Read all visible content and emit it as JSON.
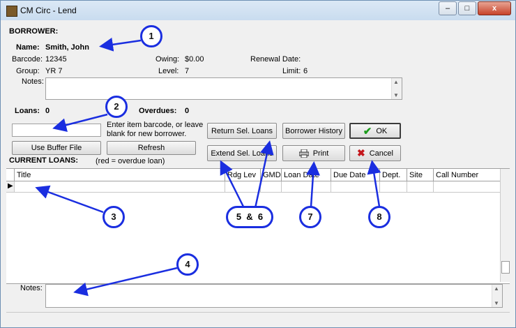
{
  "window": {
    "title": "CM Circ - Lend",
    "minimize": "–",
    "maximize": "□",
    "close": "x"
  },
  "borrower": {
    "section_label": "BORROWER:",
    "name_label": "Name:",
    "name_value": "Smith, John",
    "barcode_label": "Barcode:",
    "barcode_value": "12345",
    "group_label": "Group:",
    "group_value": "YR 7",
    "owing_label": "Owing:",
    "owing_value": "$0.00",
    "level_label": "Level:",
    "level_value": "7",
    "renewal_label": "Renewal Date:",
    "renewal_value": "",
    "limit_label": "Limit:",
    "limit_value": "6",
    "notes_label": "Notes:"
  },
  "loans": {
    "loans_label": "Loans:",
    "loans_count": "0",
    "overdues_label": "Overdues:",
    "overdues_count": "0",
    "barcode_input_value": "",
    "hint": "Enter item barcode, or leave blank for new borrower.",
    "use_buffer_label": "Use Buffer File",
    "refresh_label": "Refresh",
    "current_loans_label": "CURRENT LOANS:",
    "overdue_note": "(red = overdue loan)"
  },
  "buttons": {
    "return_sel": "Return Sel. Loans",
    "borrower_history": "Borrower History",
    "ok": "OK",
    "extend_sel": "Extend Sel. Loans",
    "print": "Print",
    "cancel": "Cancel"
  },
  "table": {
    "columns": [
      "Title",
      "Rdg Lev",
      "GMD",
      "Loan Date",
      "Due Date",
      "Dept.",
      "Site",
      "Call Number"
    ]
  },
  "bottom_notes_label": "Notes:",
  "annotations": [
    "1",
    "2",
    "3",
    "4",
    "5  &  6",
    "7",
    "8"
  ],
  "colors": {
    "annotation": "#1a2ee0",
    "ok_check": "#1a9b1a",
    "cancel_x": "#c4161c"
  },
  "icons": [
    "app-icon",
    "check-icon",
    "x-icon",
    "printer-icon",
    "row-pointer-icon"
  ]
}
